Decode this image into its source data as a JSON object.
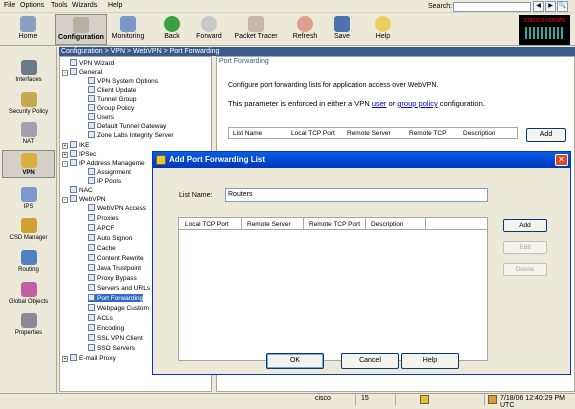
{
  "menu": [
    "File",
    "Options",
    "Tools",
    "Wizards",
    "Help"
  ],
  "search": {
    "label": "Search:",
    "value": ""
  },
  "toolbar": {
    "home": "Home",
    "configuration": "Configuration",
    "monitoring": "Monitoring",
    "back": "Back",
    "forward": "Forward",
    "packet_tracer": "Packet Tracer",
    "refresh": "Refresh",
    "save": "Save",
    "help": "Help"
  },
  "logo_text": "CISCO SYSTEMS",
  "leftbar": [
    "Interfaces",
    "Security Policy",
    "NAT",
    "VPN",
    "IPS",
    "CSD Manager",
    "Routing",
    "Global Objects",
    "Properties"
  ],
  "breadcrumb": "Configuration > VPN > WebVPN > Port Forwarding",
  "tree": {
    "vpn_wizard": "VPN Wizard",
    "general": "General",
    "vpn_system_options": "VPN System Options",
    "client_update": "Client Update",
    "tunnel_group": "Tunnel Group",
    "group_policy": "Group Policy",
    "users": "Users",
    "default_tunnel_gateway": "Default Tunnel Gateway",
    "zone_labs": "Zone Labs Integrity Server",
    "ike": "IKE",
    "ipsec": "IPSec",
    "ip_address_management": "IP Address Manageme",
    "assignment": "Assignment",
    "ip_pools": "IP Pools",
    "nac": "NAC",
    "webvpn": "WebVPN",
    "webvpn_access": "WebVPN Access",
    "proxies": "Proxies",
    "apcf": "APCF",
    "auto_signon": "Auto Signon",
    "cache": "Cache",
    "content_rewrite": "Content Rewrite",
    "java_trustpoint": "Java Trustpoint",
    "proxy_bypass": "Proxy Bypass",
    "servers_urls": "Servers and URLs",
    "port_forwarding": "Port Forwarding",
    "webpage_custom": "Webpage Custom",
    "acls": "ACLs",
    "encoding": "Encoding",
    "ssl_vpn_client": "SSL VPN Client",
    "sso_servers": "SSO Servers",
    "email_proxy": "E-mail Proxy"
  },
  "content": {
    "title": "Port Forwarding",
    "desc": "Configure port forwarding lists for application access over WebVPN.",
    "param_prefix": "This parameter is enforced in either a VPN ",
    "param_link1": "user",
    "param_mid": " or ",
    "param_link2": "group policy",
    "param_suffix": " configuration.",
    "columns": [
      "List Name",
      "Local TCP Port",
      "Remote Server",
      "Remote TCP",
      "Description"
    ],
    "add_label": "Add"
  },
  "dialog": {
    "title": "Add Port Forwarding List",
    "listname_label": "List Name:",
    "listname_value": "Routers",
    "columns": [
      "Local TCP Port",
      "Remote Server",
      "Remote TCP Port",
      "Description"
    ],
    "add": "Add",
    "edit": "Edit",
    "delete": "Delete",
    "ok": "OK",
    "cancel": "Cancel",
    "help": "Help"
  },
  "status": {
    "user": "cisco",
    "num": "15",
    "datetime": "7/18/06 12:40:29 PM UTC"
  }
}
